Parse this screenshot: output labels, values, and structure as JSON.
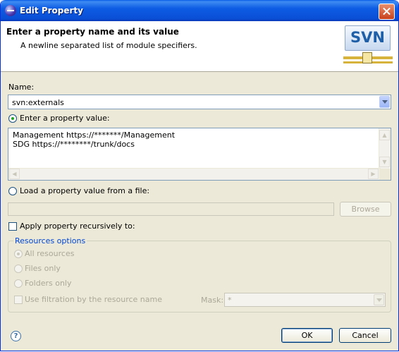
{
  "window": {
    "title": "Edit Property"
  },
  "banner": {
    "title": "Enter a property name and its value",
    "description": "A newline separated list of module specifiers.",
    "logo_text": "SVN"
  },
  "name_field": {
    "label": "Name:",
    "value": "svn:externals"
  },
  "value_option": {
    "label": "Enter a property value:",
    "selected": true,
    "lines": [
      "Management https://*******/Management",
      "SDG https://********/trunk/docs"
    ]
  },
  "file_option": {
    "label": "Load a property value from a file:",
    "selected": false,
    "path_value": "",
    "browse_label": "Browse"
  },
  "recursive": {
    "label": "Apply property recursively to:",
    "checked": false
  },
  "resources_options": {
    "title": "Resources options",
    "all": "All resources",
    "files": "Files only",
    "folders": "Folders only",
    "filtration": "Use filtration by the resource name",
    "mask_label": "Mask:",
    "mask_value": "*"
  },
  "buttons": {
    "ok": "OK",
    "cancel": "Cancel"
  },
  "icons": {
    "window": "eclipse-icon",
    "close": "close-icon",
    "help": "help-icon",
    "logo": "svn-logo"
  },
  "colors": {
    "titlebar": "#0a4fd6",
    "group_title": "#0046d5",
    "selected_radio": "#21a121"
  }
}
